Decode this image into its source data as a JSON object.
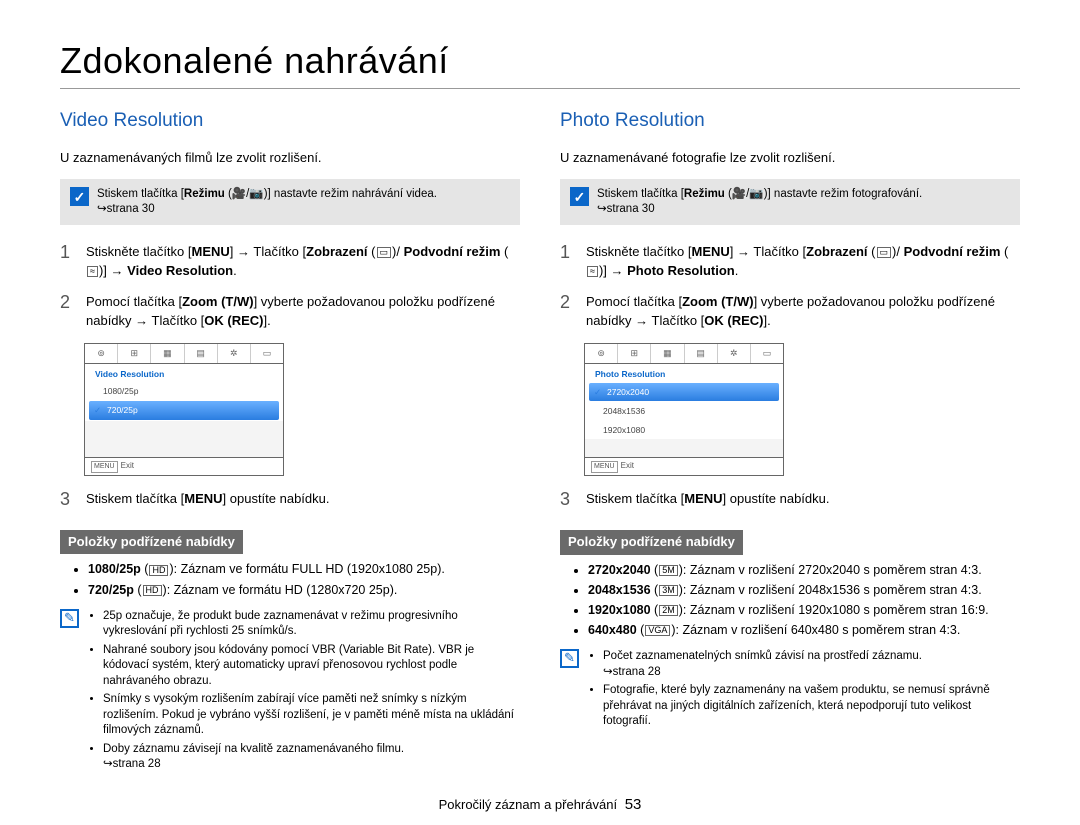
{
  "page": {
    "title": "Zdokonalené nahrávání",
    "footer_label": "Pokročilý záznam a přehrávání",
    "page_number": "53"
  },
  "arrows": "→",
  "hook_arrow": "↪",
  "left": {
    "heading": "Video Resolution",
    "intro": "U zaznamenávaných filmů lze zvolit rozlišení.",
    "note_pre": "Stiskem tlačítka [",
    "note_bold1": "Režimu",
    "note_mid": " (",
    "note_icons": "🎥/📷",
    "note_post": ")] nastavte režim nahrávání videa.",
    "note_ref": "strana 30",
    "step1_a": "Stiskněte tlačítko [",
    "step1_menu": "MENU",
    "step1_b": "] ",
    "step1_c": " Tlačítko [",
    "step1_zobr": "Zobrazení",
    "step1_d": " (",
    "step1_e": ")/",
    "step1_pod": "Podvodní režim",
    "step1_f": " (",
    "step1_g": ")] ",
    "step1_target": "Video Resolution",
    "step2_a": "Pomocí tlačítka [",
    "step2_zoom": "Zoom (T/W)",
    "step2_b": "] vyberte požadovanou položku podřízené nabídky ",
    "step2_c": " Tlačítko [",
    "step2_ok": "OK (REC)",
    "step2_d": "].",
    "menu": {
      "title": "Video Resolution",
      "items": [
        "1080/25p",
        "720/25p"
      ],
      "selected_index": 1,
      "exit": "Exit",
      "exit_btn": "MENU"
    },
    "step3_a": "Stiskem tlačítka [",
    "step3_menu": "MENU",
    "step3_b": "] opustíte nabídku.",
    "sub_head": "Položky podřízené nabídky",
    "sub_items": [
      {
        "b": "1080/25p",
        "t": ": Záznam ve formátu FULL HD (1920x1080 25p)."
      },
      {
        "b": "720/25p",
        "t": ": Záznam ve formátu HD (1280x720 25p)."
      }
    ],
    "tips": [
      "25p označuje, že produkt bude zaznamenávat v režimu progresivního vykreslování při rychlosti 25 snímků/s.",
      "Nahrané soubory jsou kódovány pomocí VBR (Variable Bit Rate). VBR je kódovací systém, který automaticky upraví přenosovou rychlost podle nahrávaného obrazu.",
      "Snímky s vysokým rozlišením zabírají více paměti než snímky s nízkým rozlišením. Pokud je vybráno vyšší rozlišení, je v paměti méně místa na ukládání filmových záznamů.",
      "Doby záznamu závisejí na kvalitě zaznamenávaného filmu."
    ],
    "tips_ref": "strana 28"
  },
  "right": {
    "heading": "Photo Resolution",
    "intro": "U zaznamenávané fotografie lze zvolit rozlišení.",
    "note_pre": "Stiskem tlačítka [",
    "note_bold1": "Režimu",
    "note_mid": " (",
    "note_icons": "🎥/📷",
    "note_post": ")] nastavte režim fotografování.",
    "note_ref": "strana 30",
    "step1_target": "Photo Resolution",
    "menu": {
      "title": "Photo Resolution",
      "items": [
        "2720x2040",
        "2048x1536",
        "1920x1080"
      ],
      "selected_index": 0,
      "exit": "Exit",
      "exit_btn": "MENU"
    },
    "sub_items": [
      {
        "b": "2720x2040",
        "t": ": Záznam v rozlišení 2720x2040 s poměrem stran 4:3."
      },
      {
        "b": "2048x1536",
        "t": ": Záznam v rozlišení 2048x1536 s poměrem stran 4:3."
      },
      {
        "b": "1920x1080",
        "t": ": Záznam v rozlišení 1920x1080 s poměrem stran 16:9."
      },
      {
        "b": "640x480",
        "t": ": Záznam v rozlišení 640x480 s poměrem stran 4:3."
      }
    ],
    "tips": [
      "Počet zaznamenatelných snímků závisí na prostředí záznamu.",
      "Fotografie, které byly zaznamenány na vašem produktu, se nemusí správně přehrávat na jiných digitálních zařízeních, která nepodporují tuto velikost fotografií."
    ],
    "tips_ref": "strana 28"
  }
}
